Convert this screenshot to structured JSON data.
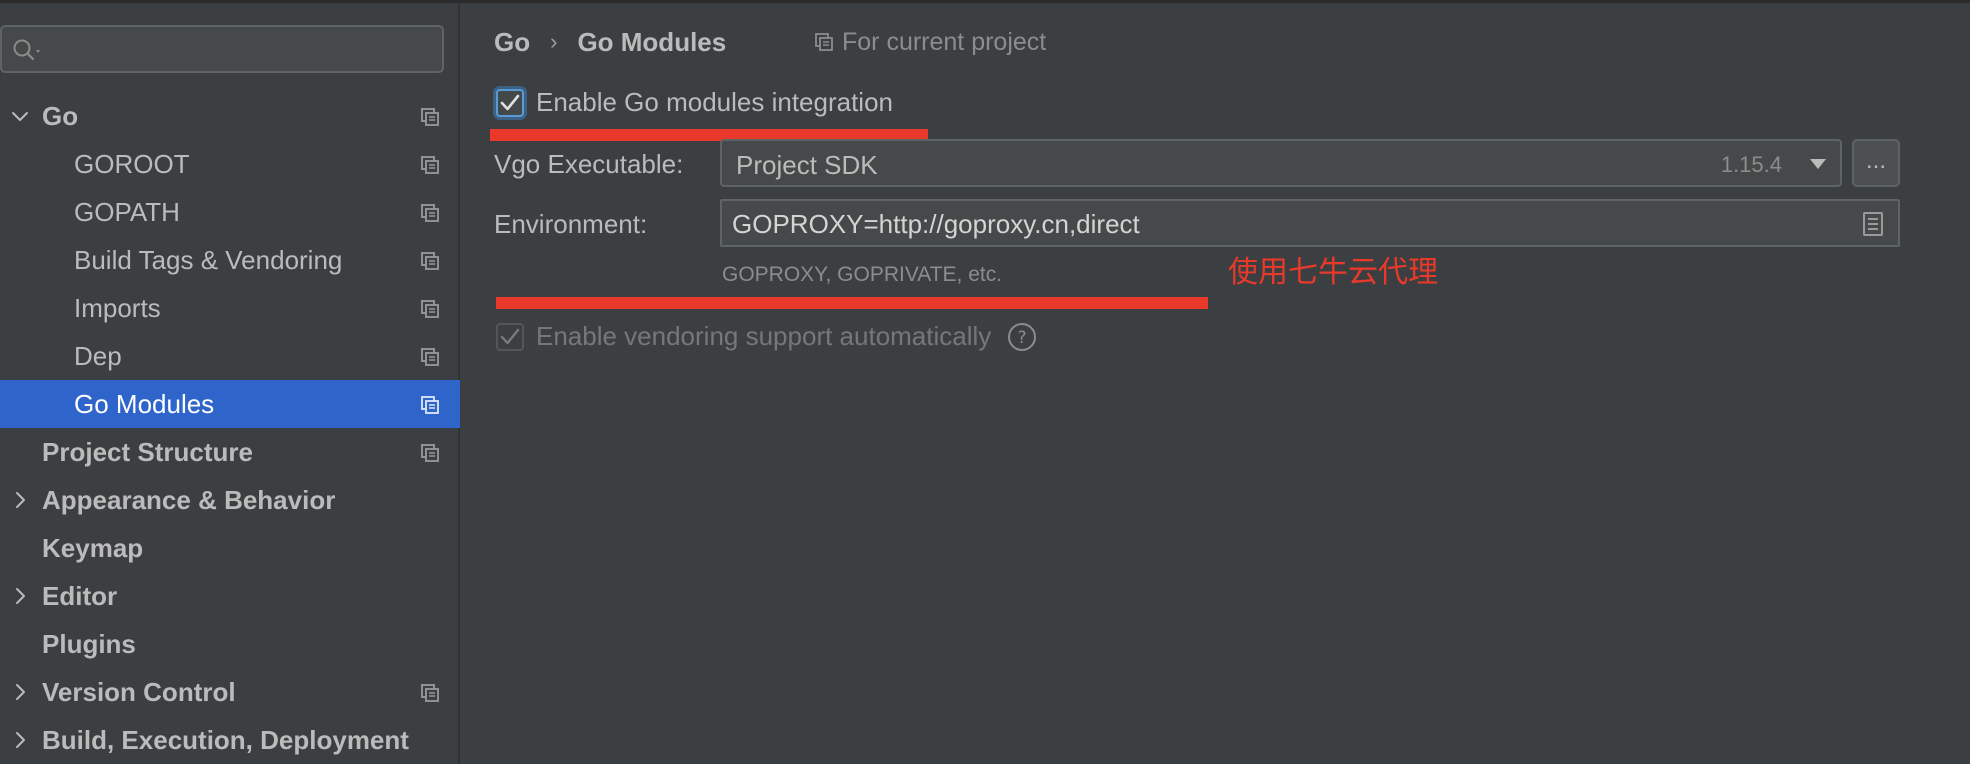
{
  "search": {
    "value": "",
    "placeholder": ""
  },
  "sidebar": {
    "items": [
      {
        "label": "Go",
        "level": 0,
        "expandable": true,
        "expanded": true,
        "project_icon": true
      },
      {
        "label": "GOROOT",
        "level": 1,
        "project_icon": true
      },
      {
        "label": "GOPATH",
        "level": 1,
        "project_icon": true
      },
      {
        "label": "Build Tags & Vendoring",
        "level": 1,
        "project_icon": true
      },
      {
        "label": "Imports",
        "level": 1,
        "project_icon": true
      },
      {
        "label": "Dep",
        "level": 1,
        "project_icon": true
      },
      {
        "label": "Go Modules",
        "level": 1,
        "selected": true,
        "project_icon": true
      },
      {
        "label": "Project Structure",
        "level": 0,
        "project_icon": true
      },
      {
        "label": "Appearance & Behavior",
        "level": 0,
        "expandable": true
      },
      {
        "label": "Keymap",
        "level": 0
      },
      {
        "label": "Editor",
        "level": 0,
        "expandable": true
      },
      {
        "label": "Plugins",
        "level": 0
      },
      {
        "label": "Version Control",
        "level": 0,
        "expandable": true,
        "project_icon": true
      },
      {
        "label": "Build, Execution, Deployment",
        "level": 0,
        "expandable": true
      }
    ]
  },
  "breadcrumb": {
    "parent": "Go",
    "separator": "›",
    "current": "Go Modules"
  },
  "scope_note": "For current project",
  "modules": {
    "enable_label": "Enable Go modules integration",
    "enable_checked": true
  },
  "vgo": {
    "label": "Vgo Executable:",
    "value": "Project SDK",
    "version": "1.15.4",
    "more_label": "..."
  },
  "environment": {
    "label": "Environment:",
    "value": "GOPROXY=http://goproxy.cn,direct",
    "hint": "GOPROXY, GOPRIVATE, etc."
  },
  "annotation": "使用七牛云代理",
  "vendoring": {
    "label": "Enable vendoring support automatically",
    "checked": true,
    "disabled": true
  },
  "colors": {
    "background": "#3c3f41",
    "selected": "#2f65ca",
    "annotation_red": "#e8392a"
  }
}
